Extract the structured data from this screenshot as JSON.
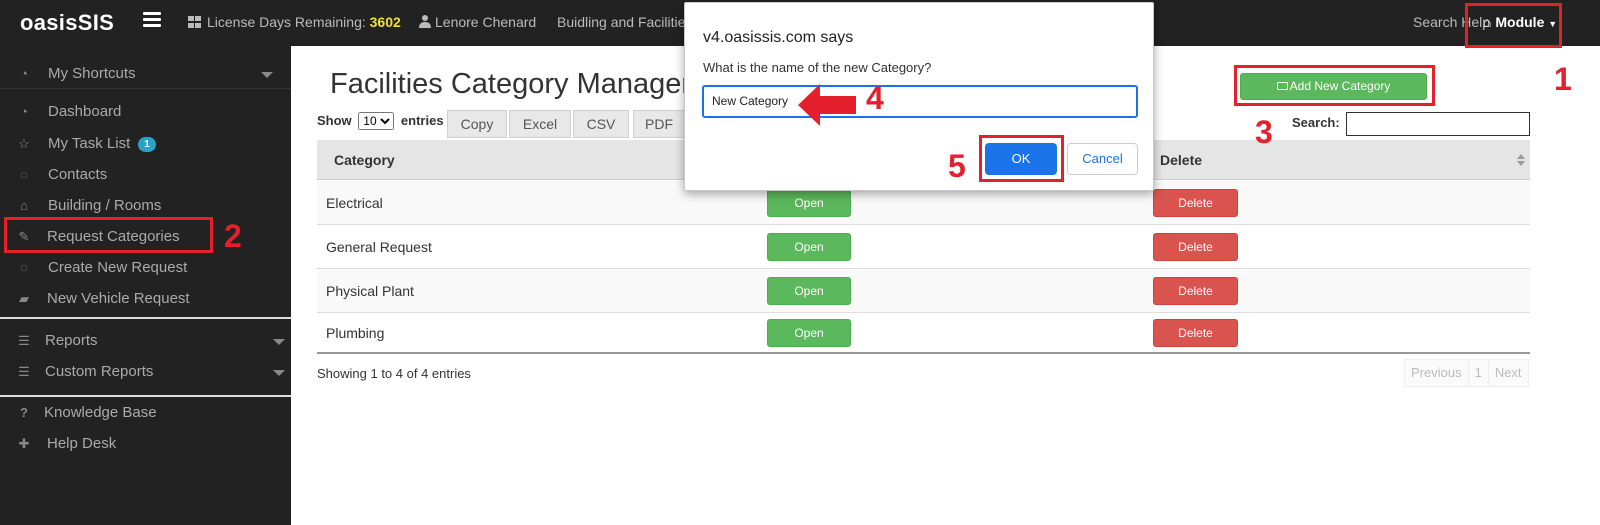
{
  "header": {
    "brand": "oasisSIS",
    "license_label": "License Days Remaining:",
    "license_days": "3602",
    "user_name": "Lenore Chenard",
    "breadcrumb": "Buidling and Facilities",
    "search_help": "Search Help",
    "module_label": "Module"
  },
  "sidebar": {
    "items": [
      {
        "label": "My Shortcuts",
        "icon": "dashboard-icon"
      },
      {
        "label": "Dashboard",
        "icon": "dashboard-icon"
      },
      {
        "label": "My Task List",
        "icon": "star-icon",
        "badge": "1"
      },
      {
        "label": "Contacts",
        "icon": "comments-icon"
      },
      {
        "label": "Building / Rooms",
        "icon": "home-icon"
      },
      {
        "label": "Request Categories",
        "icon": "wrench-icon"
      },
      {
        "label": "Create New Request",
        "icon": "comments-icon"
      },
      {
        "label": "New Vehicle Request",
        "icon": "car-icon"
      },
      {
        "label": "Reports",
        "icon": "list-icon"
      },
      {
        "label": "Custom Reports",
        "icon": "list-icon"
      },
      {
        "label": "Knowledge Base",
        "icon": "question-icon"
      },
      {
        "label": "Help Desk",
        "icon": "medkit-icon"
      }
    ]
  },
  "main": {
    "title": "Facilities Category Manager",
    "show_label": "Show",
    "entries_label": "entries",
    "page_length": "10",
    "export_buttons": [
      "Copy",
      "Excel",
      "CSV",
      "PDF"
    ],
    "add_button": "Add New Category",
    "search_label": "Search:",
    "columns": [
      "Category",
      "Delete"
    ],
    "rows": [
      {
        "category": "Electrical",
        "open": "Open",
        "delete": "Delete"
      },
      {
        "category": "General Request",
        "open": "Open",
        "delete": "Delete"
      },
      {
        "category": "Physical Plant",
        "open": "Open",
        "delete": "Delete"
      },
      {
        "category": "Plumbing",
        "open": "Open",
        "delete": "Delete"
      }
    ],
    "showing": "Showing 1 to 4 of 4 entries",
    "pagination": [
      "Previous",
      "1",
      "Next"
    ]
  },
  "dialog": {
    "title": "v4.oasissis.com says",
    "message": "What is the name of the new Category?",
    "value": "New Category",
    "ok": "OK",
    "cancel": "Cancel"
  },
  "annotations": [
    "1",
    "2",
    "3",
    "4",
    "5"
  ],
  "colors": {
    "topbar": "#222222",
    "highlight": "#e3202b",
    "success": "#5cb85c",
    "danger": "#d9534f",
    "dialog_accent": "#1a73e8",
    "license_highlight": "#f0e030"
  }
}
